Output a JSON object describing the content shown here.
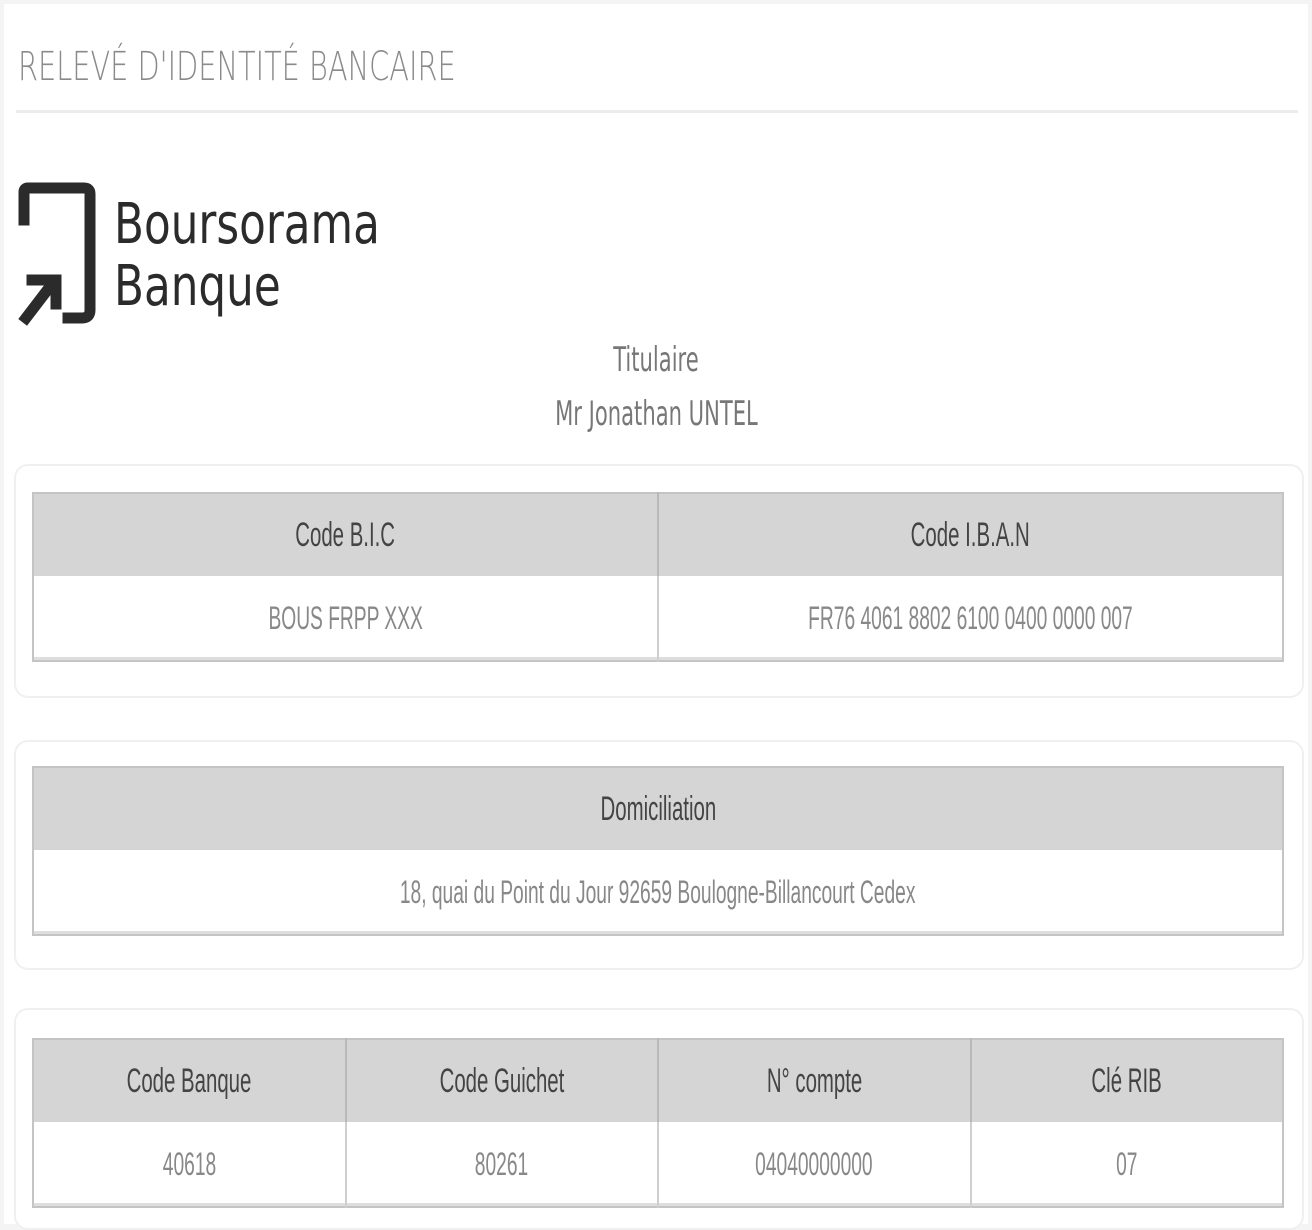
{
  "document": {
    "title": "RELEVÉ D'IDENTITÉ BANCAIRE"
  },
  "bank": {
    "name_line1": "Boursorama",
    "name_line2": "Banque",
    "logo_icon": "boursorama-logo-icon"
  },
  "holder": {
    "label": "Titulaire",
    "name": "Mr Jonathan  UNTEL"
  },
  "account_ids": {
    "headers": [
      "Code B.I.C",
      "Code I.B.A.N"
    ],
    "values": [
      "BOUS FRPP XXX",
      "FR76 4061 8802 6100 0400 0000 007"
    ]
  },
  "domiciliation": {
    "header": "Domiciliation",
    "value": "18, quai du Point du Jour 92659 Boulogne-Billancourt Cedex"
  },
  "rib": {
    "headers": [
      "Code Banque",
      "Code Guichet",
      "N° compte",
      "Clé RIB"
    ],
    "values": [
      "40618",
      "80261",
      "04040000000",
      "07"
    ]
  },
  "colors": {
    "header_bg": "#d5d5d5",
    "brand_text": "#2b2b2b",
    "muted_text": "#888888"
  }
}
